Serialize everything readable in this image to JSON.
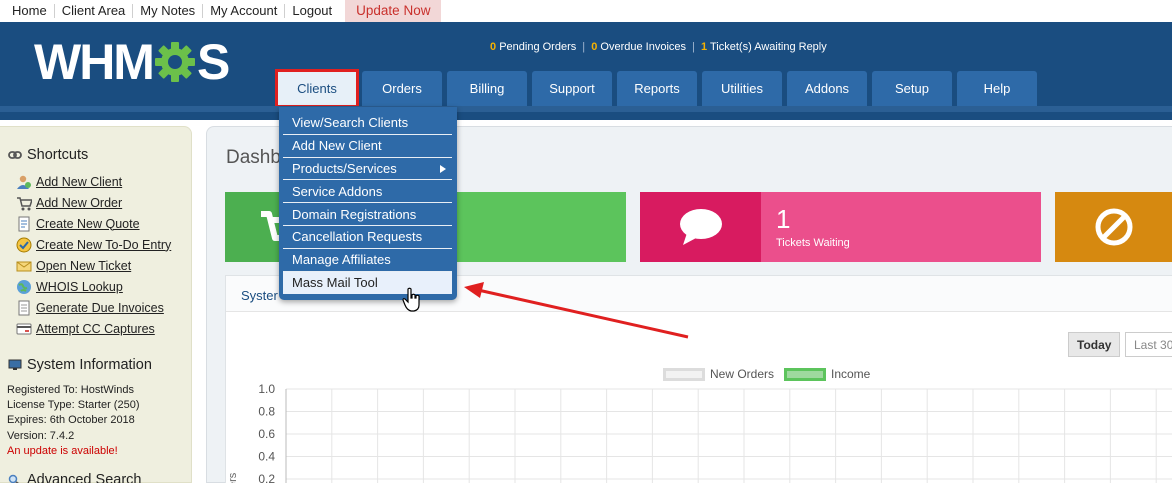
{
  "toplinks": {
    "items": [
      "Home",
      "Client Area",
      "My Notes",
      "My Account",
      "Logout"
    ],
    "update_label": "Update Now"
  },
  "header": {
    "logo_left": "WHM",
    "logo_right": "S",
    "stats": {
      "pending_orders_count": "0",
      "pending_orders_label": "Pending Orders",
      "overdue_count": "0",
      "overdue_label": "Overdue Invoices",
      "tickets_count": "1",
      "tickets_label": "Ticket(s) Awaiting Reply",
      "separator": "|"
    }
  },
  "nav": {
    "tabs": [
      "Clients",
      "Orders",
      "Billing",
      "Support",
      "Reports",
      "Utilities",
      "Addons",
      "Setup",
      "Help"
    ],
    "active": "Clients"
  },
  "dropdown": {
    "items": [
      "View/Search Clients",
      "Add New Client",
      "Products/Services",
      "Service Addons",
      "Domain Registrations",
      "Cancellation Requests",
      "Manage Affiliates",
      "Mass Mail Tool"
    ],
    "hovered": "Mass Mail Tool"
  },
  "sidebar": {
    "shortcuts_title": "Shortcuts",
    "shortcuts": [
      "Add New Client",
      "Add New Order",
      "Create New Quote",
      "Create New To-Do Entry",
      "Open New Ticket",
      "WHOIS Lookup",
      "Generate Due Invoices",
      "Attempt CC Captures"
    ],
    "sysinfo_title": "System Information",
    "sysinfo": {
      "registered": "Registered To: HostWinds",
      "license": "License Type: Starter (250)",
      "expires": "Expires: 6th October 2018",
      "version": "Version: 7.4.2",
      "update": "An update is available!"
    },
    "advsearch_title": "Advanced Search"
  },
  "main": {
    "title": "Dashb",
    "tickets_count": "1",
    "tickets_label": "Tickets Waiting",
    "panel_title": "Syster",
    "range_today": "Today",
    "range_last": "Last 30",
    "legend_orders": "New Orders",
    "legend_income": "Income",
    "axis_partial_label": "ers"
  },
  "chart_data": {
    "type": "line",
    "series": [
      {
        "name": "New Orders",
        "values": []
      },
      {
        "name": "Income",
        "values": []
      }
    ],
    "ylim": [
      0,
      1.0
    ],
    "yticks": [
      "1.0",
      "0.8",
      "0.6",
      "0.4",
      "0.2"
    ],
    "grid": true,
    "legend_position": "top-center"
  },
  "colors": {
    "header_blue": "#1a4d80",
    "tab_blue": "#2e6aa8",
    "green": "#5cc45c",
    "pink": "#eb4f8c",
    "orange": "#e6a43a",
    "annotation_red": "#e02020"
  }
}
